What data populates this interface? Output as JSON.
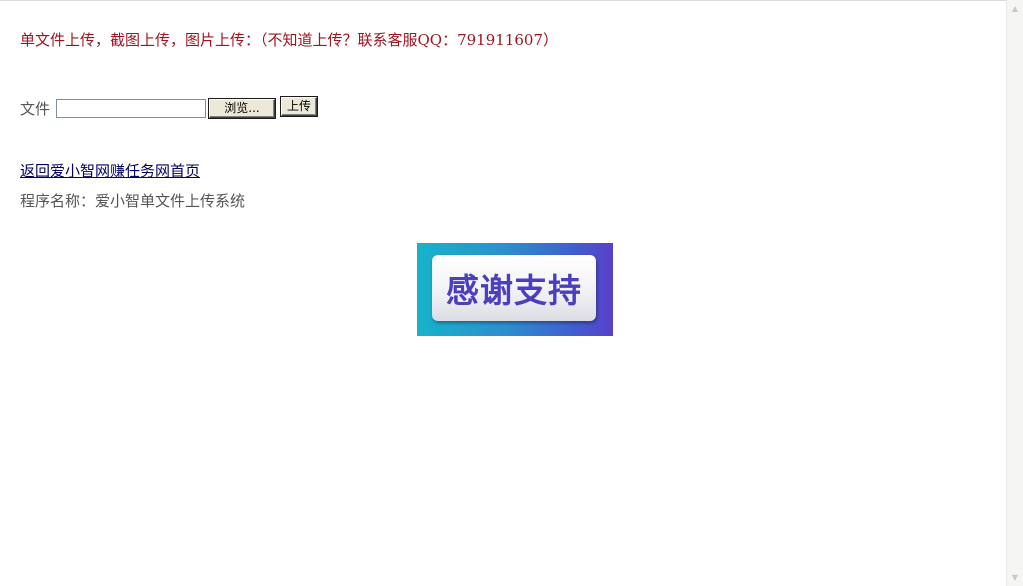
{
  "notice": {
    "text": "单文件上传，截图上传，图片上传：（不知道上传？联系客服QQ：791911607）"
  },
  "upload_form": {
    "file_label": "文件",
    "file_value": "",
    "browse_label": "浏览...",
    "upload_label": "上传"
  },
  "links": {
    "home": "返回爱小智网赚任务网首页"
  },
  "program": {
    "name": "程序名称：爱小智单文件上传系统"
  },
  "banner": {
    "text": "感谢支持"
  },
  "scrollbar": {
    "up_icon": "▲",
    "down_icon": "▼"
  },
  "colors": {
    "notice": "#a0141e",
    "link": "#000066",
    "banner_text": "#4b3fbf"
  }
}
